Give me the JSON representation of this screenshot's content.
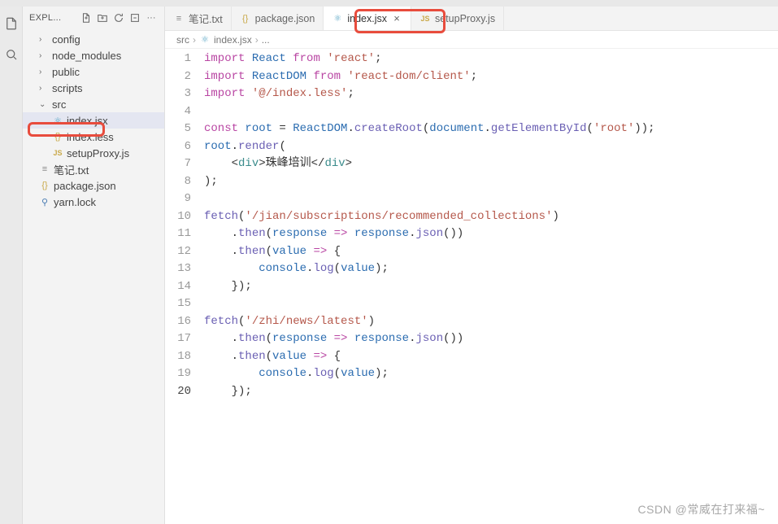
{
  "sidebar": {
    "title": "EXPL...",
    "items": [
      {
        "label": "config",
        "type": "folder",
        "indent": 1
      },
      {
        "label": "node_modules",
        "type": "folder",
        "indent": 1
      },
      {
        "label": "public",
        "type": "folder",
        "indent": 1
      },
      {
        "label": "scripts",
        "type": "folder",
        "indent": 1
      },
      {
        "label": "src",
        "type": "folder-open",
        "indent": 1
      },
      {
        "label": "index.jsx",
        "type": "react",
        "indent": 2,
        "active": true
      },
      {
        "label": "index.less",
        "type": "json",
        "indent": 2
      },
      {
        "label": "setupProxy.js",
        "type": "js",
        "indent": 2
      },
      {
        "label": "笔记.txt",
        "type": "txt",
        "indent": 1
      },
      {
        "label": "package.json",
        "type": "json",
        "indent": 1
      },
      {
        "label": "yarn.lock",
        "type": "yarn",
        "indent": 1
      }
    ]
  },
  "tabs": [
    {
      "label": "笔记.txt",
      "icon": "txt"
    },
    {
      "label": "package.json",
      "icon": "json"
    },
    {
      "label": "index.jsx",
      "icon": "react",
      "active": true,
      "closeable": true
    },
    {
      "label": "setupProxy.js",
      "icon": "js"
    }
  ],
  "breadcrumb": {
    "seg1": "src",
    "seg2": "index.jsx",
    "seg3": "..."
  },
  "code": {
    "lines": [
      {
        "n": 1,
        "html": "<span class='tk-kw'>import</span> <span class='tk-var'>React</span> <span class='tk-kw'>from</span> <span class='tk-str'>'react'</span>;"
      },
      {
        "n": 2,
        "html": "<span class='tk-kw'>import</span> <span class='tk-var'>ReactDOM</span> <span class='tk-kw'>from</span> <span class='tk-str'>'react-dom/client'</span>;"
      },
      {
        "n": 3,
        "html": "<span class='tk-kw'>import</span> <span class='tk-str'>'@/index.less'</span>;"
      },
      {
        "n": 4,
        "html": ""
      },
      {
        "n": 5,
        "html": "<span class='tk-kw'>const</span> <span class='tk-var'>root</span> = <span class='tk-var'>ReactDOM</span>.<span class='tk-fn'>createRoot</span>(<span class='tk-var'>document</span>.<span class='tk-fn'>getElementById</span>(<span class='tk-str'>'root'</span>));"
      },
      {
        "n": 6,
        "html": "<span class='tk-var'>root</span>.<span class='tk-fn'>render</span>("
      },
      {
        "n": 7,
        "html": "    &lt;<span class='tk-type'>div</span>&gt;珠峰培训&lt;/<span class='tk-type'>div</span>&gt;"
      },
      {
        "n": 8,
        "html": ");"
      },
      {
        "n": 9,
        "html": ""
      },
      {
        "n": 10,
        "html": "<span class='tk-fn'>fetch</span>(<span class='tk-str'>'/jian/subscriptions/recommended_collections'</span>)"
      },
      {
        "n": 11,
        "html": "    .<span class='tk-fn'>then</span>(<span class='tk-var'>response</span> <span class='tk-kw'>=&gt;</span> <span class='tk-var'>response</span>.<span class='tk-fn'>json</span>())"
      },
      {
        "n": 12,
        "html": "    .<span class='tk-fn'>then</span>(<span class='tk-var'>value</span> <span class='tk-kw'>=&gt;</span> {"
      },
      {
        "n": 13,
        "html": "        <span class='tk-var'>console</span>.<span class='tk-fn'>log</span>(<span class='tk-var'>value</span>);"
      },
      {
        "n": 14,
        "html": "    });"
      },
      {
        "n": 15,
        "html": ""
      },
      {
        "n": 16,
        "html": "<span class='tk-fn'>fetch</span>(<span class='tk-str'>'/zhi/news/latest'</span>)"
      },
      {
        "n": 17,
        "html": "    .<span class='tk-fn'>then</span>(<span class='tk-var'>response</span> <span class='tk-kw'>=&gt;</span> <span class='tk-var'>response</span>.<span class='tk-fn'>json</span>())"
      },
      {
        "n": 18,
        "html": "    .<span class='tk-fn'>then</span>(<span class='tk-var'>value</span> <span class='tk-kw'>=&gt;</span> {"
      },
      {
        "n": 19,
        "html": "        <span class='tk-var'>console</span>.<span class='tk-fn'>log</span>(<span class='tk-var'>value</span>);"
      },
      {
        "n": 20,
        "html": "    });",
        "current": true
      }
    ]
  },
  "watermark": "CSDN @常威在打来福~"
}
